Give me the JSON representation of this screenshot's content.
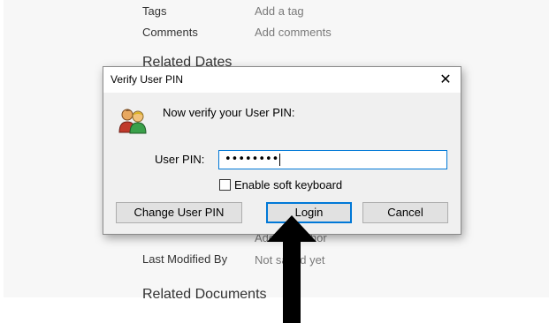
{
  "properties": {
    "tags_label": "Tags",
    "tags_value": "Add a tag",
    "comments_label": "Comments",
    "comments_value": "Add comments",
    "related_dates_heading": "Related Dates",
    "author_value_partial": "Add an author",
    "last_modified_label": "Last Modified By",
    "last_modified_value": "Not saved yet",
    "related_documents_heading": "Related Documents"
  },
  "dialog": {
    "title": "Verify User PIN",
    "close_glyph": "✕",
    "prompt": "Now verify your User PIN:",
    "pin_label": "User PIN:",
    "pin_value": "••••••••",
    "soft_keyboard_label": "Enable soft keyboard",
    "soft_keyboard_checked": false,
    "buttons": {
      "change_pin": "Change User PIN",
      "login": "Login",
      "cancel": "Cancel"
    },
    "icon": "users-icon",
    "accent_color": "#0078d7"
  },
  "annotation": {
    "icon": "arrow-up-icon",
    "color": "#000000"
  }
}
